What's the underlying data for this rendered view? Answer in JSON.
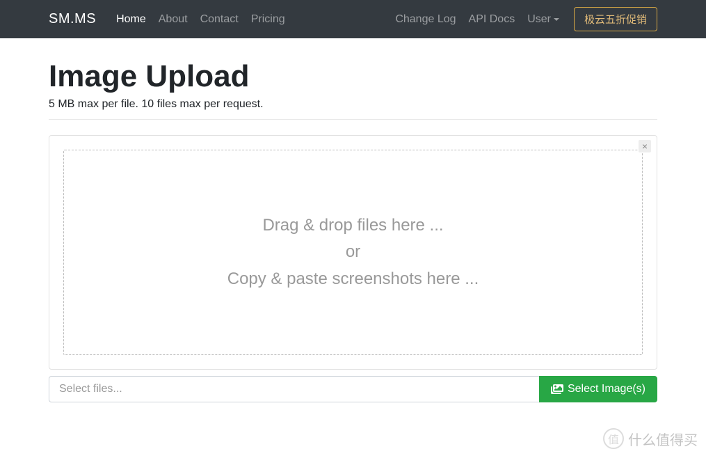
{
  "navbar": {
    "brand": "SM.MS",
    "left_links": [
      {
        "label": "Home",
        "active": true
      },
      {
        "label": "About",
        "active": false
      },
      {
        "label": "Contact",
        "active": false
      },
      {
        "label": "Pricing",
        "active": false
      }
    ],
    "right_links": [
      {
        "label": "Change Log"
      },
      {
        "label": "API Docs"
      }
    ],
    "user_label": "User",
    "promo_label": "极云五折促销"
  },
  "page": {
    "title": "Image Upload",
    "subtitle": "5 MB max per file. 10 files max per request."
  },
  "dropzone": {
    "line1": "Drag & drop files here ...",
    "line2": "or",
    "line3": "Copy & paste screenshots here ..."
  },
  "file_input": {
    "placeholder": "Select files...",
    "button_label": "Select Image(s)"
  },
  "watermark": {
    "icon_text": "值",
    "text": "什么值得买"
  }
}
